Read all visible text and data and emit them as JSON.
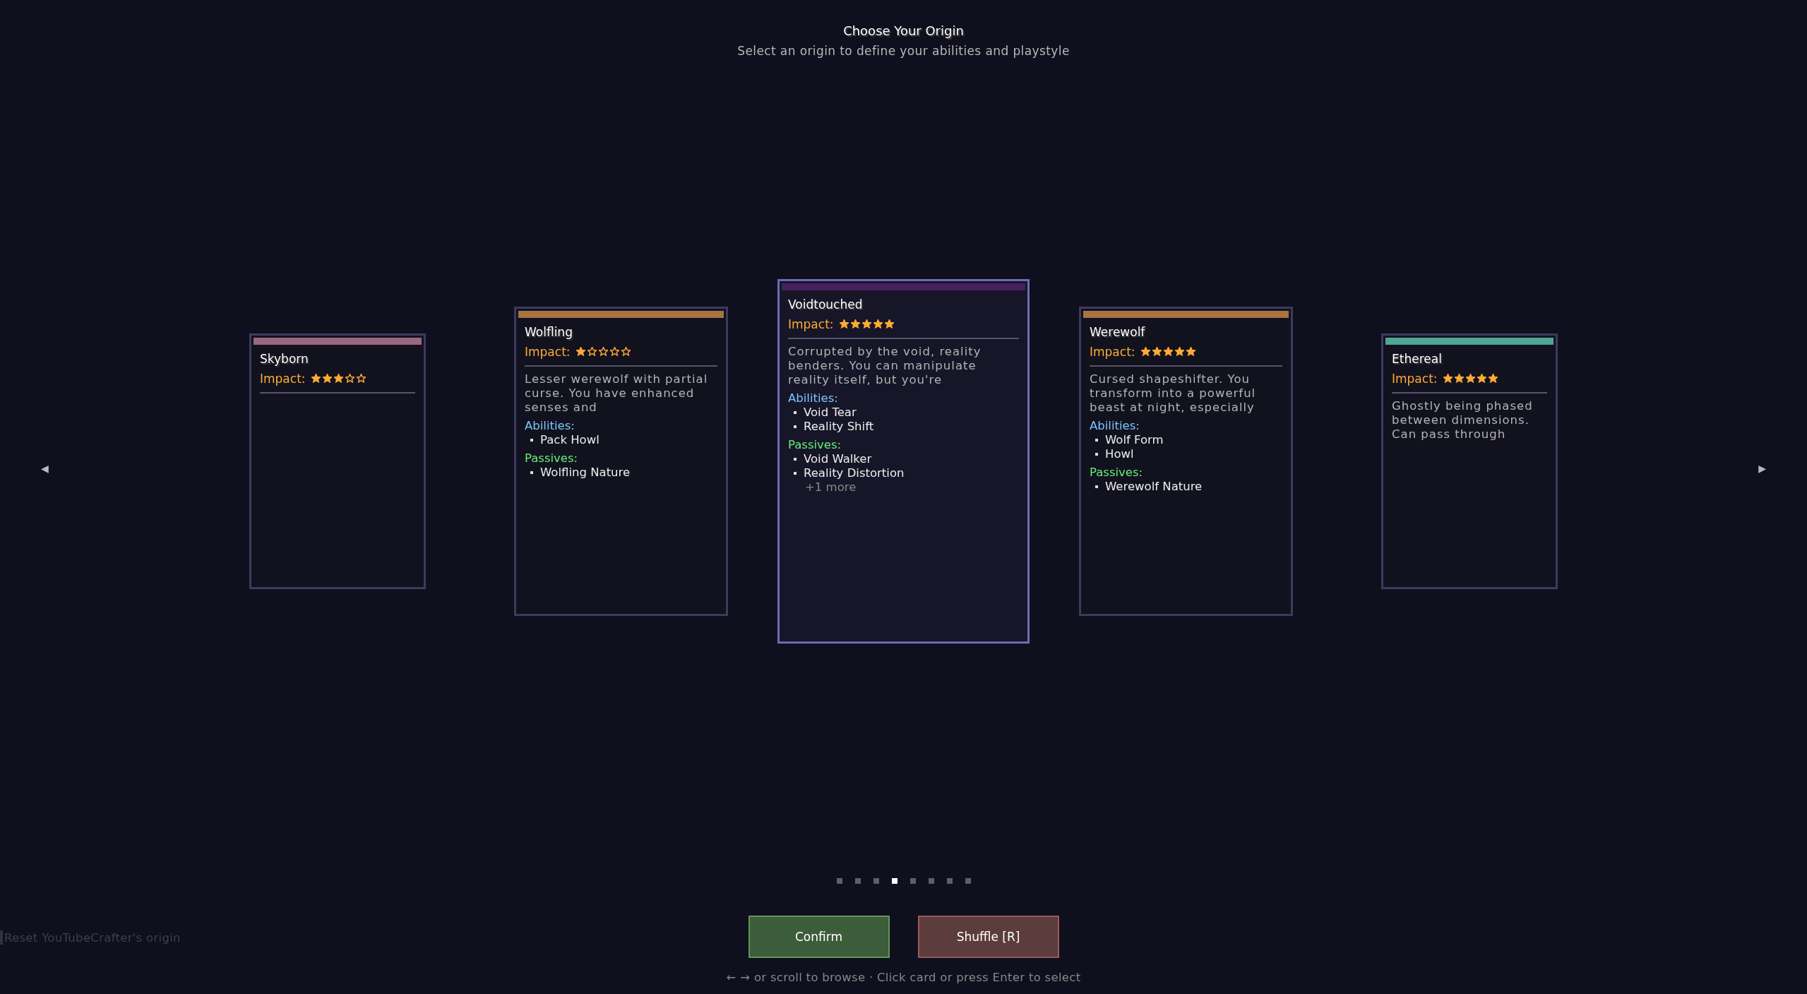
{
  "header": {
    "title": "Choose Your Origin",
    "subtitle": "Select an origin to define your abilities and playstyle"
  },
  "nav": {
    "prev": "◀",
    "next": "▶"
  },
  "cards": [
    {
      "name": "Skyborn",
      "selected": false,
      "color": "#9a6680",
      "impact_label": "Impact:",
      "stars": 3
    },
    {
      "name": "Wolfling",
      "selected": false,
      "color": "#a87440",
      "impact_label": "Impact:",
      "stars": 1,
      "description": "Lesser werewolf with partial curse. You have enhanced senses and",
      "sections": [
        {
          "kind": "abilities",
          "label": "Abilities:",
          "items": [
            "Pack Howl"
          ]
        },
        {
          "kind": "passives",
          "label": "Passives:",
          "items": [
            "Wolfling Nature"
          ]
        }
      ]
    },
    {
      "name": "Voidtouched",
      "selected": true,
      "color": "#46215e",
      "impact_label": "Impact:",
      "stars": 5,
      "description": "Corrupted by the void, reality benders. You can manipulate reality itself, but you're",
      "sections": [
        {
          "kind": "abilities",
          "label": "Abilities:",
          "items": [
            "Void Tear",
            "Reality Shift"
          ]
        },
        {
          "kind": "passives",
          "label": "Passives:",
          "items": [
            "Void Walker",
            "Reality Distortion"
          ],
          "more": "+1 more"
        }
      ]
    },
    {
      "name": "Werewolf",
      "selected": false,
      "color": "#a87440",
      "impact_label": "Impact:",
      "stars": 5,
      "description": "Cursed shapeshifter. You transform into a powerful beast at night, especially",
      "sections": [
        {
          "kind": "abilities",
          "label": "Abilities:",
          "items": [
            "Wolf Form",
            "Howl"
          ]
        },
        {
          "kind": "passives",
          "label": "Passives:",
          "items": [
            "Werewolf Nature"
          ]
        }
      ]
    },
    {
      "name": "Ethereal",
      "selected": false,
      "color": "#4fa596",
      "impact_label": "Impact:",
      "stars": 5,
      "description": "Ghostly being phased between dimensions. Can pass through"
    }
  ],
  "pager": [
    {
      "selected": false
    },
    {
      "selected": false
    },
    {
      "selected": false
    },
    {
      "selected": true
    },
    {
      "selected": false
    },
    {
      "selected": false
    },
    {
      "selected": false
    },
    {
      "selected": false
    }
  ],
  "buttons": [
    {
      "kind": "confirm",
      "label": "Confirm"
    },
    {
      "kind": "shuffle",
      "label": "Shuffle [R]"
    }
  ],
  "hint": "← → or scroll to browse · Click card or press Enter to select",
  "chat_suggestion": "Reset YouTubeCrafter's origin"
}
